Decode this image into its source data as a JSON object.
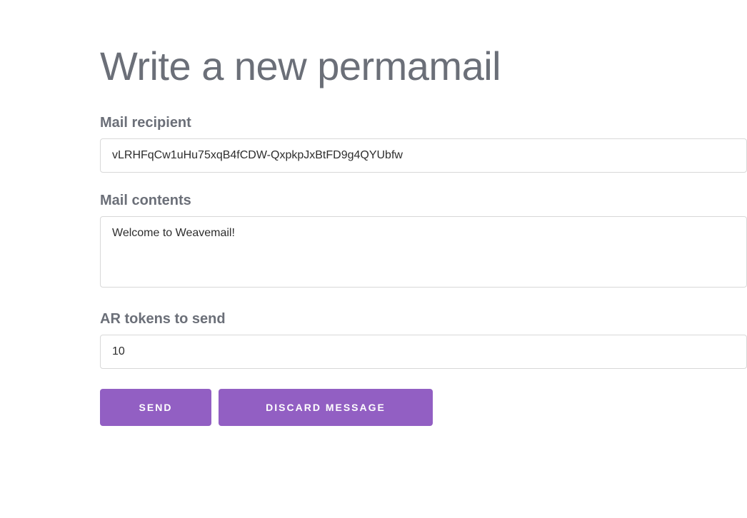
{
  "header": {
    "title": "Write a new permamail"
  },
  "form": {
    "recipient": {
      "label": "Mail recipient",
      "value": "vLRHFqCw1uHu75xqB4fCDW-QxpkpJxBtFD9g4QYUbfw"
    },
    "contents": {
      "label": "Mail contents",
      "value": "Welcome to Weavemail!"
    },
    "tokens": {
      "label": "AR tokens to send",
      "value": "10"
    }
  },
  "buttons": {
    "send": "SEND",
    "discard": "DISCARD MESSAGE"
  },
  "colors": {
    "accent": "#925fc3",
    "textMuted": "#6b6f78",
    "border": "#d8d8d8"
  }
}
